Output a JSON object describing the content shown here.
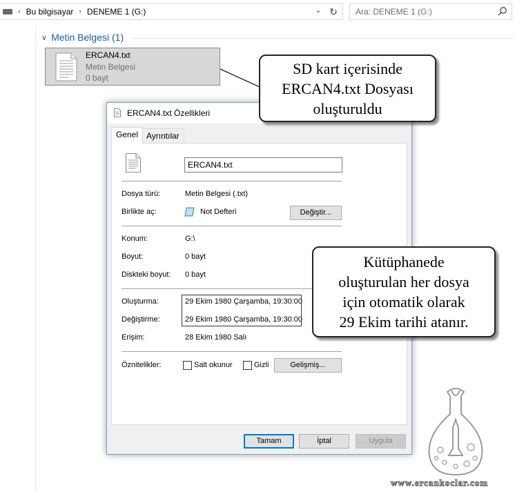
{
  "explorer": {
    "breadcrumbs": [
      "Bu bilgisayar",
      "DENEME 1 (G:)"
    ],
    "search_placeholder": "Ara: DENEME 1 (G:)",
    "group_header": "Metin Belgesi (1)",
    "file": {
      "name": "ERCAN4.txt",
      "type": "Metin Belgesi",
      "size": "0 bayt"
    }
  },
  "dialog": {
    "title": "ERCAN4.txt Özellikleri",
    "tabs": [
      "Genel",
      "Ayrıntılar"
    ],
    "file_name_value": "ERCAN4.txt",
    "rows": {
      "file_type": {
        "label": "Dosya türü:",
        "value": "Metin Belgesi (.txt)"
      },
      "opens_with": {
        "label": "Birlikte aç:",
        "value": "Not Defteri",
        "button": "Değiştir..."
      },
      "location": {
        "label": "Konum:",
        "value": "G:\\"
      },
      "size": {
        "label": "Boyut:",
        "value": "0 bayt"
      },
      "size_on_disk": {
        "label": "Diskteki boyut:",
        "value": "0 bayt"
      },
      "created": {
        "label": "Oluşturma:",
        "value": "29 Ekim 1980 Çarşamba, 19:30:00"
      },
      "modified": {
        "label": "Değiştirme:",
        "value": "29 Ekim 1980 Çarşamba, 19:30:00"
      },
      "accessed": {
        "label": "Erişim:",
        "value": "28 Ekim 1980 Salı"
      }
    },
    "attributes": {
      "label": "Öznitelikler:",
      "readonly": "Salt okunur",
      "hidden": "Gizli",
      "advanced_button": "Gelişmiş..."
    },
    "buttons": {
      "ok": "Tamam",
      "cancel": "İptal",
      "apply": "Uygula"
    }
  },
  "callouts": {
    "top": [
      "SD kart içerisinde",
      "ERCAN4.txt Dosyası",
      "oluşturuldu"
    ],
    "right": [
      "Kütüphanede",
      "oluşturulan her dosya",
      "için otomatik olarak",
      "29 Ekim tarihi atanır."
    ]
  },
  "watermark": "www.ercankoclar.com"
}
